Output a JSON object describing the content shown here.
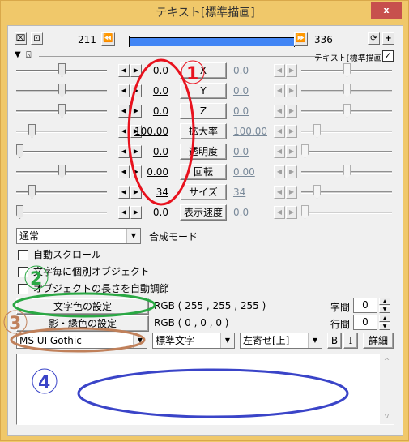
{
  "window": {
    "title": "テキスト[標準描画]",
    "close_label": "x"
  },
  "toolbar": {
    "start_frame": "211",
    "end_frame": "336",
    "progress_fraction": 1.0,
    "object_label": "テキスト[標準描画]",
    "object_enabled": true,
    "timeline_color": "#4285f4"
  },
  "params": [
    {
      "label": "X",
      "value": "0.0",
      "end_value": "0.0",
      "slider_left": 0.5,
      "slider_right": 0.5
    },
    {
      "label": "Y",
      "value": "0.0",
      "end_value": "0.0",
      "slider_left": 0.5,
      "slider_right": 0.5
    },
    {
      "label": "Z",
      "value": "0.0",
      "end_value": "0.0",
      "slider_left": 0.5,
      "slider_right": 0.5
    },
    {
      "label": "拡大率",
      "value": "100.00",
      "end_value": "100.00",
      "slider_left": 0.15,
      "slider_right": 0.15
    },
    {
      "label": "透明度",
      "value": "0.0",
      "end_value": "0.0",
      "slider_left": 0.0,
      "slider_right": 0.0
    },
    {
      "label": "回転",
      "value": "0.00",
      "end_value": "0.00",
      "slider_left": 0.5,
      "slider_right": 0.5
    },
    {
      "label": "サイズ",
      "value": "34",
      "end_value": "34",
      "slider_left": 0.15,
      "slider_right": 0.15
    },
    {
      "label": "表示速度",
      "value": "0.0",
      "end_value": "0.0",
      "slider_left": 0.0,
      "slider_right": 0.0
    }
  ],
  "blend": {
    "selected": "通常",
    "label": "合成モード"
  },
  "checkboxes": [
    {
      "label": "自動スクロール",
      "checked": false
    },
    {
      "label": "文字毎に個別オブジェクト",
      "checked": false
    },
    {
      "label": "オブジェクトの長さを自動調節",
      "checked": false
    }
  ],
  "colors": {
    "text_color_button": "文字色の設定",
    "text_color_value": "RGB ( 255 , 255 , 255 )",
    "shadow_color_button": "影・縁色の設定",
    "shadow_color_value": "RGB ( 0 , 0 , 0 )"
  },
  "spacing": {
    "char_label": "字間",
    "char_value": "0",
    "line_label": "行間",
    "line_value": "0"
  },
  "font": {
    "family": "MS UI Gothic",
    "style": "標準文字",
    "align": "左寄せ[上]",
    "bold_label": "B",
    "italic_label": "I",
    "detail_label": "詳細"
  },
  "text_content": "",
  "annotations": [
    {
      "marker": "①",
      "color": "#e8121e"
    },
    {
      "marker": "②",
      "color": "#2aa844"
    },
    {
      "marker": "③",
      "color": "#c0805a"
    },
    {
      "marker": "④",
      "color": "#3a44c8"
    }
  ]
}
